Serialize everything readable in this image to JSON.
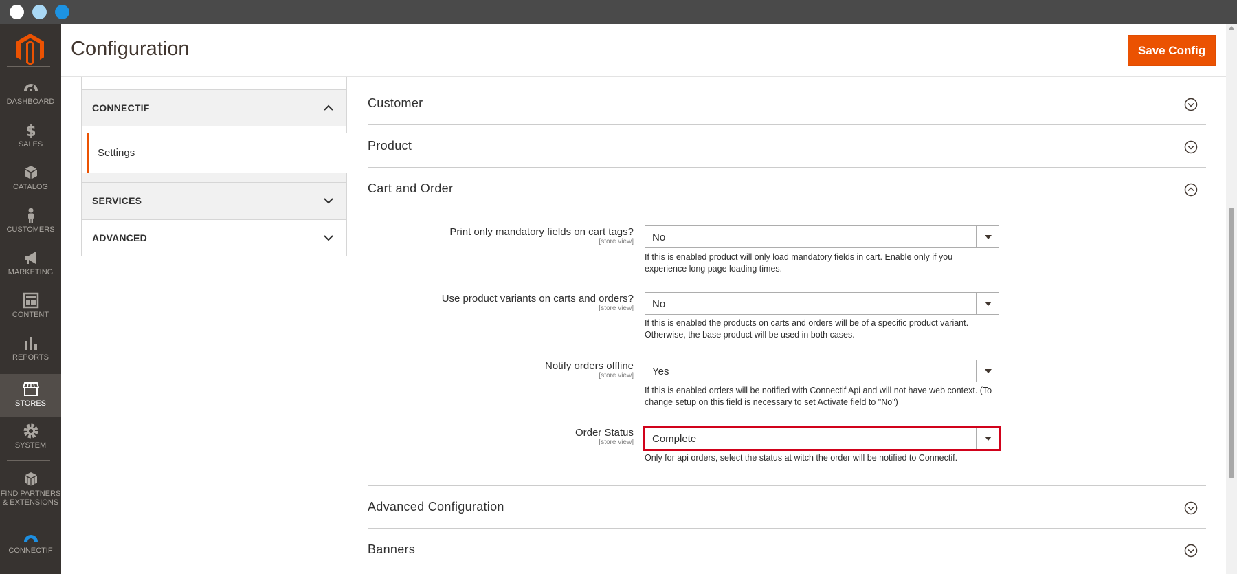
{
  "header": {
    "title": "Configuration",
    "save_label": "Save Config"
  },
  "sidebar": {
    "items": [
      {
        "label": "DASHBOARD",
        "icon": "dashboard-icon"
      },
      {
        "label": "SALES",
        "icon": "dollar-icon"
      },
      {
        "label": "CATALOG",
        "icon": "box-icon"
      },
      {
        "label": "CUSTOMERS",
        "icon": "person-icon"
      },
      {
        "label": "MARKETING",
        "icon": "megaphone-icon"
      },
      {
        "label": "CONTENT",
        "icon": "layout-icon"
      },
      {
        "label": "REPORTS",
        "icon": "bar-chart-icon"
      },
      {
        "label": "STORES",
        "icon": "store-icon",
        "active": true
      },
      {
        "label": "SYSTEM",
        "icon": "gear-icon"
      },
      {
        "label_line1": "FIND PARTNERS",
        "label_line2": "& EXTENSIONS",
        "icon": "extensions-icon"
      },
      {
        "label": "CONNECTIF",
        "icon": "connectif-icon"
      }
    ]
  },
  "tabs": {
    "connectif": "CONNECTIF",
    "settings": "Settings",
    "services": "SERVICES",
    "advanced": "ADVANCED"
  },
  "sections": {
    "customer": "Customer",
    "product": "Product",
    "cart_order": "Cart and Order",
    "advanced_config": "Advanced Configuration",
    "banners": "Banners"
  },
  "fields": [
    {
      "label": "Print only mandatory fields on cart tags?",
      "scope": "[store view]",
      "value": "No",
      "note_line1": "If this is enabled product will only load mandatory fields in cart. Enable only if you",
      "note_line2": "experience long page loading times."
    },
    {
      "label": "Use product variants on carts and orders?",
      "scope": "[store view]",
      "value": "No",
      "note_line1": "If this is enabled the products on carts and orders will be of a specific product variant.",
      "note_line2": "Otherwise, the base product will be used in both cases."
    },
    {
      "label": "Notify orders offline",
      "scope": "[store view]",
      "value": "Yes",
      "note_line1": "If this is enabled orders will be notified with Connectif Api and will not have web context. (To",
      "note_line2": "change setup on this field is necessary to set Activate field to \"No\")"
    },
    {
      "label": "Order Status",
      "scope": "[store view]",
      "value": "Complete",
      "note_line1": "Only for api orders, select the status at witch the order will be notified to Connectif."
    }
  ],
  "colors": {
    "accent": "#eb5202",
    "sidebar": "#373330",
    "highlight": "#d1021b"
  }
}
